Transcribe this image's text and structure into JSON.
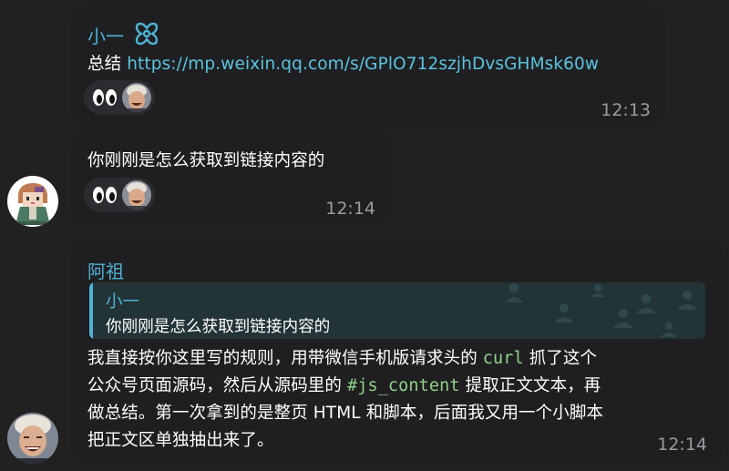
{
  "messages": [
    {
      "sender": "小一",
      "text_prefix": "总结 ",
      "link": "https://mp.weixin.qq.com/s/GPlO712szjhDvsGHMsk60w",
      "time": "12:13",
      "reactions": [
        "eyes-emoji",
        "avatar-reaction"
      ]
    },
    {
      "text": "你刚刚是怎么获取到链接内容的",
      "time": "12:14",
      "reactions": [
        "eyes-emoji",
        "avatar-reaction"
      ]
    },
    {
      "sender": "阿祖",
      "reply": {
        "sender": "小一",
        "text": "你刚刚是怎么获取到链接内容的"
      },
      "body": {
        "l1a": "我直接按你这里写的规则，用带微信手机版请求头的 ",
        "l1code": "curl",
        "l1b": " 抓了这个",
        "l2a": "公众号页面源码，然后从源码里的 ",
        "l2code": "#js_content",
        "l2b": " 提取正文文本，再",
        "l3": "做总结。第一次拿到的是整页 HTML 和脚本，后面我又用一个小脚本",
        "l4": "把正文区单独抽出来了。"
      },
      "time": "12:14"
    }
  ],
  "colors": {
    "background": "#212121",
    "bubble": "#1f1f21",
    "accent": "#4fb3d4",
    "link": "#5cc3df",
    "code": "#90d08a",
    "time": "#9a9aa0",
    "reply_background": "#233437"
  }
}
